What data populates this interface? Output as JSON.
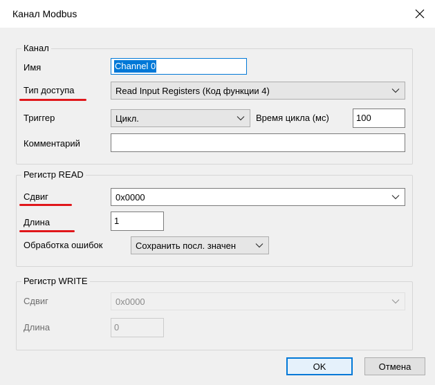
{
  "window": {
    "title": "Канал Modbus"
  },
  "channel_group": {
    "legend": "Канал",
    "name_label": "Имя",
    "name_value": "Channel 0",
    "access_label": "Тип доступа",
    "access_value": "Read Input Registers (Код функции 4)",
    "trigger_label": "Триггер",
    "trigger_value": "Цикл.",
    "cycle_label": "Время цикла (мс)",
    "cycle_value": "100",
    "comment_label": "Комментарий",
    "comment_value": ""
  },
  "read_group": {
    "legend": "Регистр READ",
    "offset_label": "Сдвиг",
    "offset_value": "0x0000",
    "length_label": "Длина",
    "length_value": "1",
    "error_label": "Обработка ошибок",
    "error_value": "Сохранить посл. значен"
  },
  "write_group": {
    "legend": "Регистр WRITE",
    "offset_label": "Сдвиг",
    "offset_value": "0x0000",
    "length_label": "Длина",
    "length_value": "0"
  },
  "buttons": {
    "ok": "OK",
    "cancel": "Отмена"
  },
  "annotation_color": "#e0161a",
  "icons": {
    "close": "close-icon",
    "dropdown": "chevron-down-icon"
  }
}
